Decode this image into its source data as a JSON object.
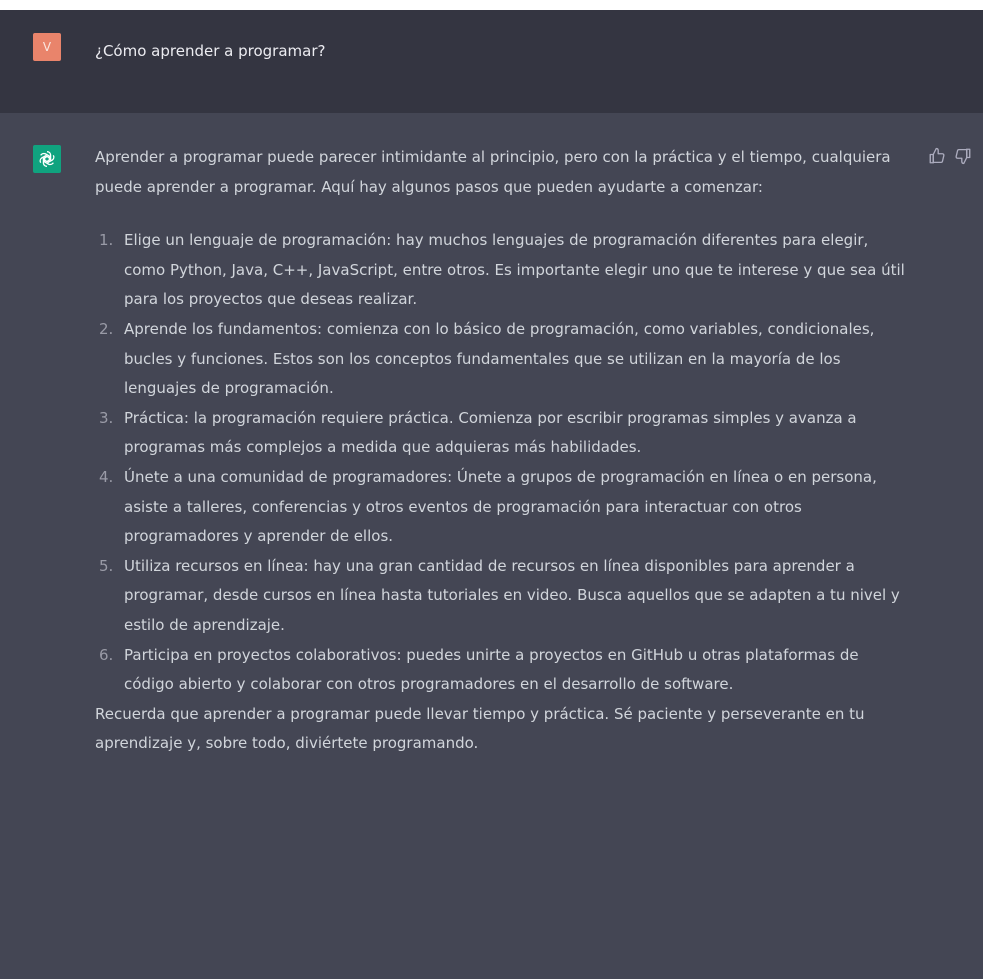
{
  "user": {
    "avatar_letter": "V",
    "question": "¿Cómo aprender a programar?"
  },
  "assistant": {
    "intro": "Aprender a programar puede parecer intimidante al principio, pero con la práctica y el tiempo, cualquiera puede aprender a programar. Aquí hay algunos pasos que pueden ayudarte a comenzar:",
    "steps": [
      {
        "num": "1.",
        "text": "Elige un lenguaje de programación: hay muchos lenguajes de programación diferentes para elegir, como Python, Java, C++, JavaScript, entre otros. Es importante elegir uno que te interese y que sea útil para los proyectos que deseas realizar."
      },
      {
        "num": "2.",
        "text": "Aprende los fundamentos: comienza con lo básico de programación, como variables, condicionales, bucles y funciones. Estos son los conceptos fundamentales que se utilizan en la mayoría de los lenguajes de programación."
      },
      {
        "num": "3.",
        "text": "Práctica: la programación requiere práctica. Comienza por escribir programas simples y avanza a programas más complejos a medida que adquieras más habilidades."
      },
      {
        "num": "4.",
        "text": "Únete a una comunidad de programadores: Únete a grupos de programación en línea o en persona, asiste a talleres, conferencias y otros eventos de programación para interactuar con otros programadores y aprender de ellos."
      },
      {
        "num": "5.",
        "text": "Utiliza recursos en línea: hay una gran cantidad de recursos en línea disponibles para aprender a programar, desde cursos en línea hasta tutoriales en video. Busca aquellos que se adapten a tu nivel y estilo de aprendizaje."
      },
      {
        "num": "6.",
        "text": "Participa en proyectos colaborativos: puedes unirte a proyectos en GitHub u otras plataformas de código abierto y colaborar con otros programadores en el desarrollo de software."
      }
    ],
    "outro": "Recuerda que aprender a programar puede llevar tiempo y práctica. Sé paciente y perseverante en tu aprendizaje y, sobre todo, diviértete programando."
  },
  "icons": {
    "bot_avatar": "openai-logo-icon",
    "thumbs_up": "thumbs-up-icon",
    "thumbs_down": "thumbs-down-icon"
  },
  "colors": {
    "user_avatar": "#e9846b",
    "bot_avatar": "#10a37f",
    "user_bg": "#343541",
    "assistant_bg": "#444654"
  }
}
